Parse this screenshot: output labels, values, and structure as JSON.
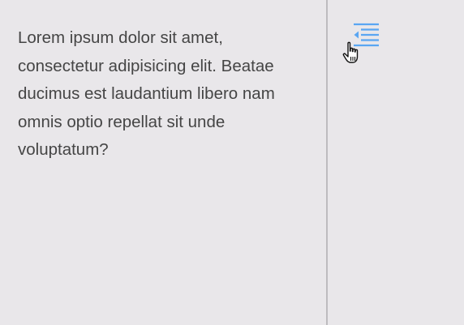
{
  "content": {
    "paragraph": "Lorem ipsum dolor sit amet, consectetur adipisicing elit. Beatae ducimus est laudantium libero nam omnis optio repellat sit unde voluptatum?"
  },
  "sidebar": {
    "toolbar_icon": "outdent-icon",
    "cursor_icon": "pointing-hand-cursor-icon"
  },
  "colors": {
    "icon_accent": "#5aa6f2",
    "text": "#454545",
    "background": "#e9e7ea",
    "divider": "#bdbbbf"
  }
}
